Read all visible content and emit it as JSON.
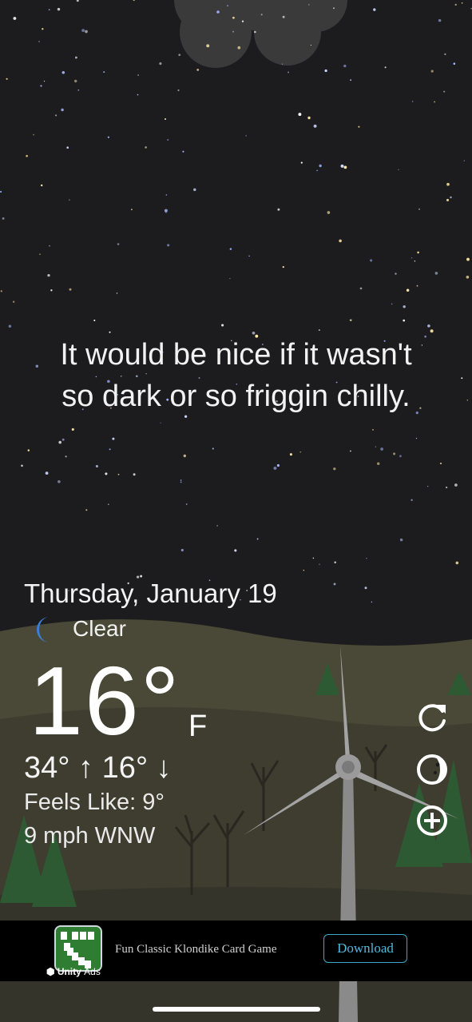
{
  "message": {
    "line1": "It would be nice if it wasn't",
    "line2": "so dark or so friggin chilly."
  },
  "weather": {
    "date": "Thursday, January 19",
    "condition": "Clear",
    "condition_icon": "crescent-moon-icon",
    "temperature": "16°",
    "unit": "F",
    "high_low": "34° ↑ 16° ↓",
    "feels_like": "Feels Like: 9°",
    "wind": "9 mph WNW"
  },
  "side_actions": [
    {
      "name": "refresh-button",
      "icon": "refresh-icon"
    },
    {
      "name": "moon-phase-button",
      "icon": "moon-phase-icon"
    },
    {
      "name": "add-location-button",
      "icon": "plus-circle-icon"
    }
  ],
  "ad": {
    "brand": "Unity",
    "brand_suffix": "Ads",
    "text": "Fun Classic Klondike Card Game",
    "button_label": "Download",
    "accent": "#3fa7c9"
  },
  "colors": {
    "sky": "#1c1c1e",
    "hills": "#4a4836",
    "ground": "#35342a",
    "moon_icon": "#3d7fd6"
  }
}
